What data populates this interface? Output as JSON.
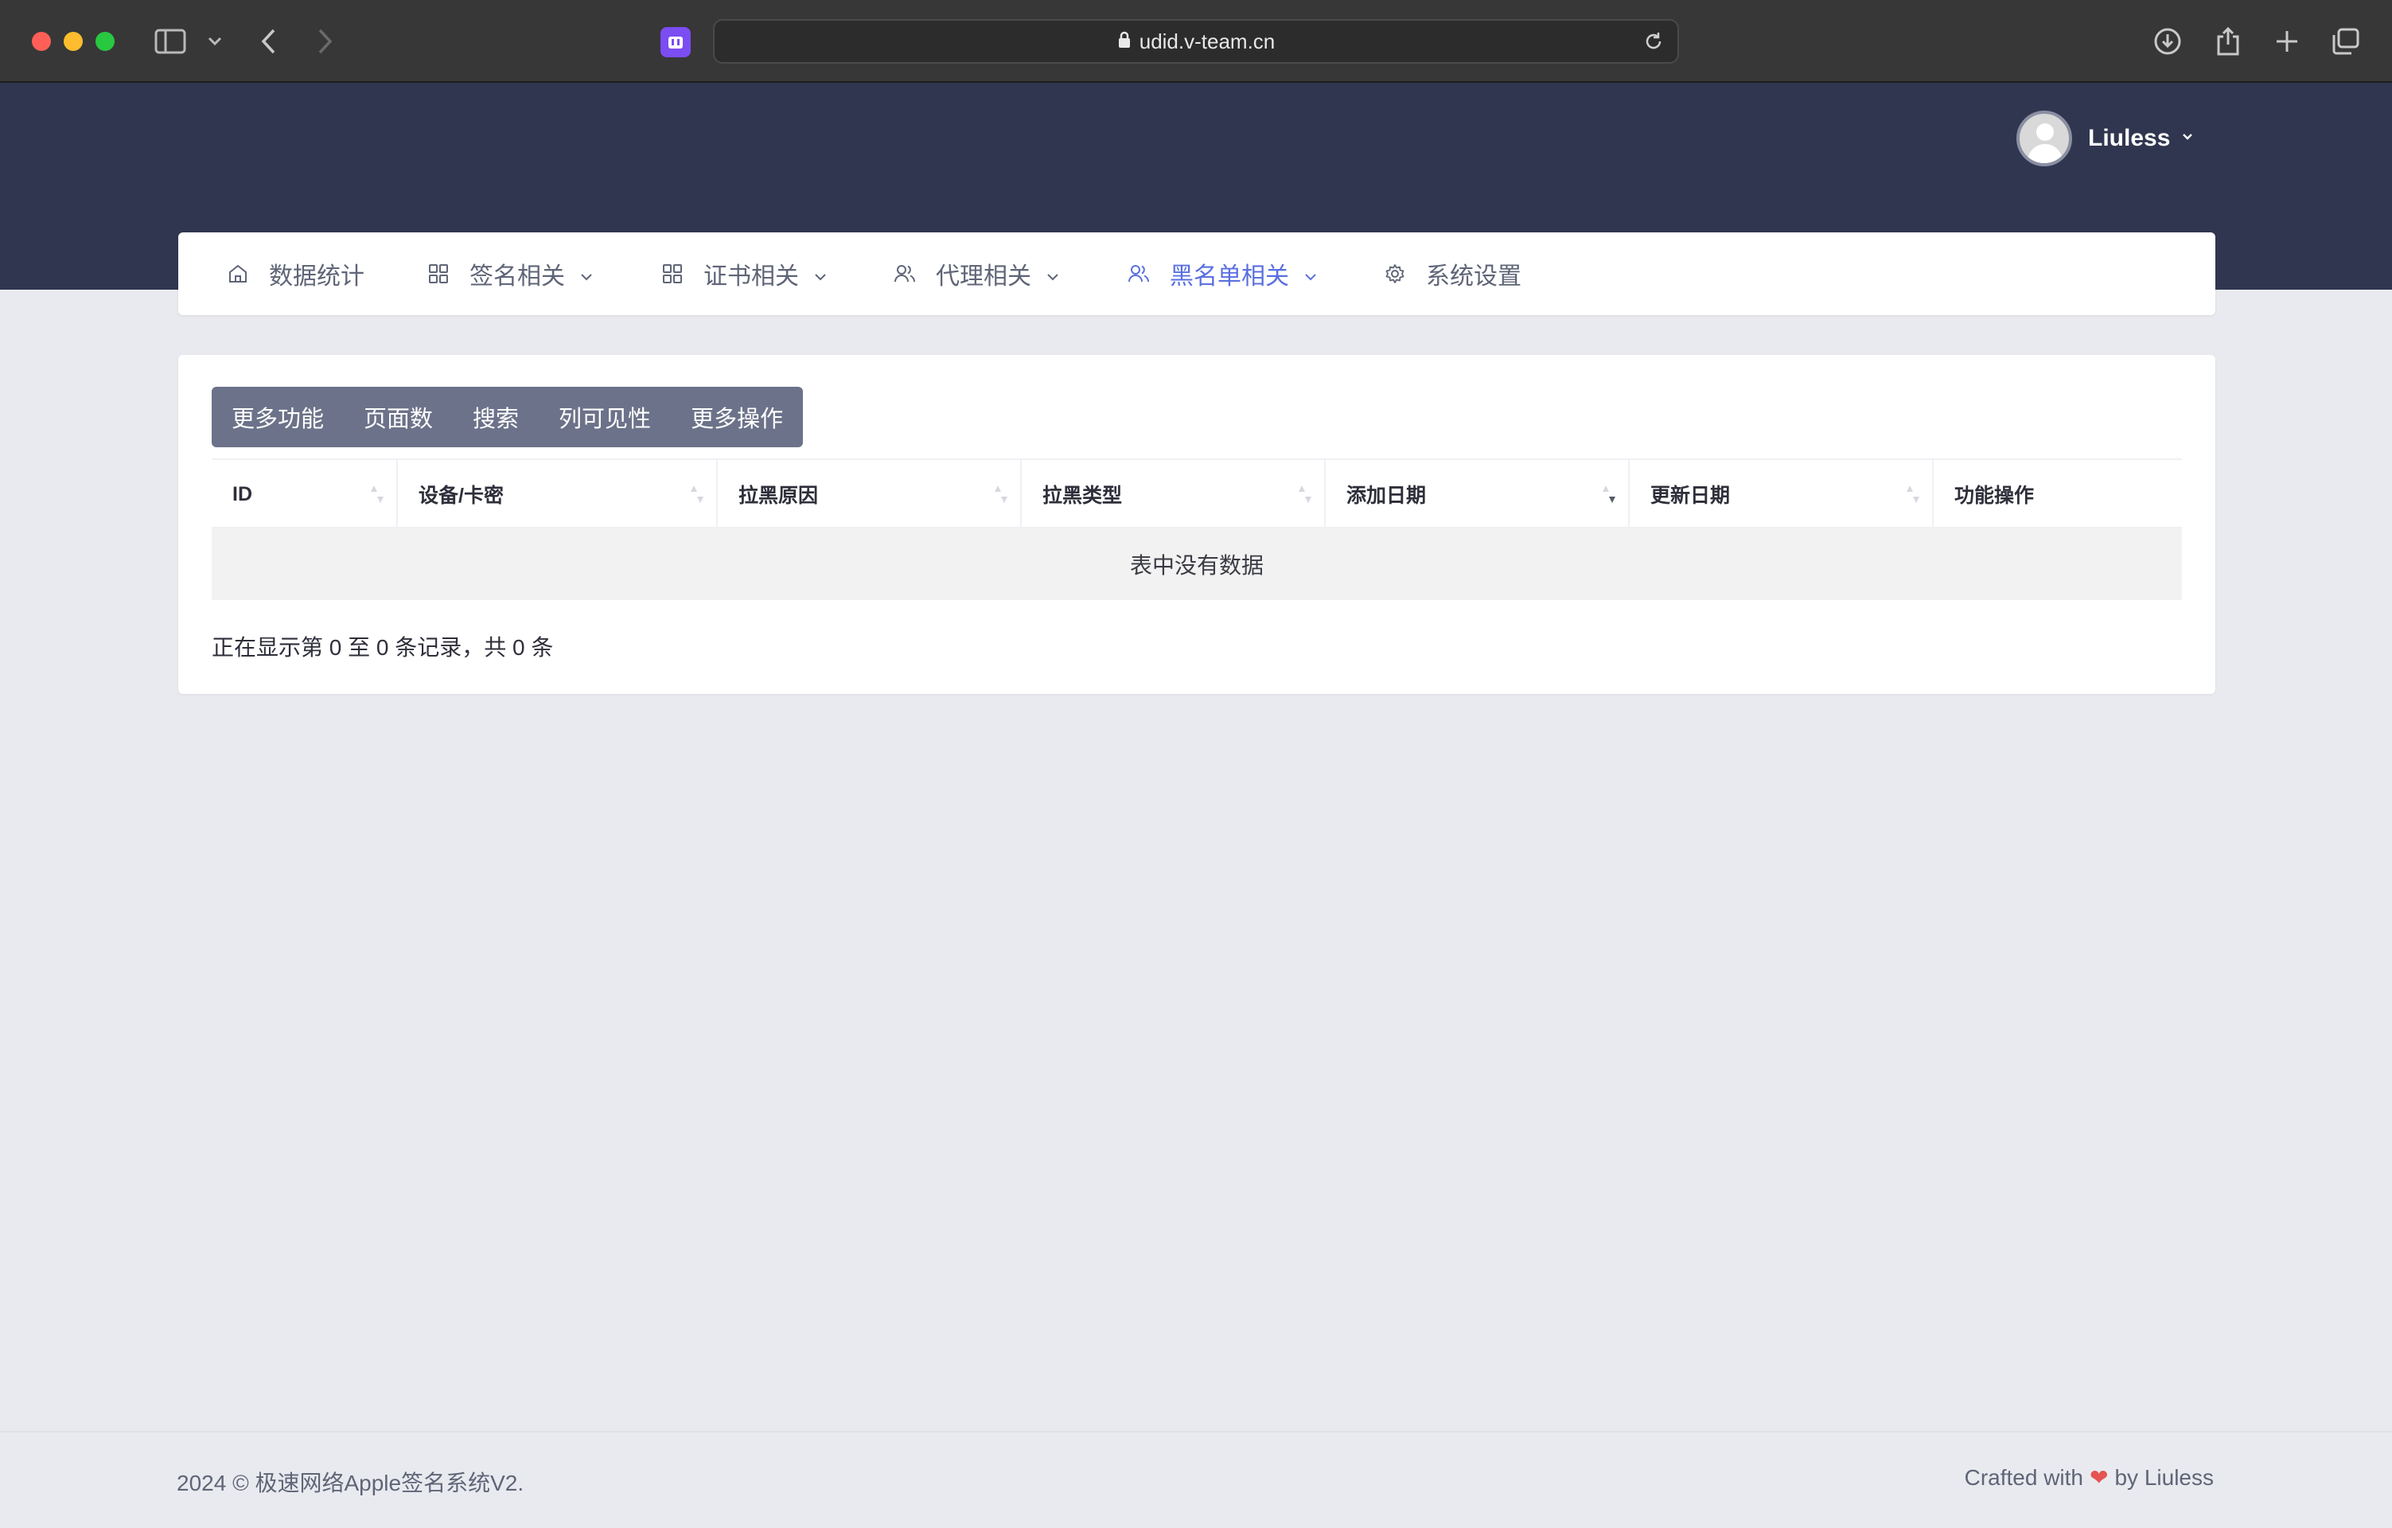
{
  "browser": {
    "url": "udid.v-team.cn"
  },
  "header": {
    "user_name": "Liuless"
  },
  "nav": {
    "items": [
      {
        "label": "数据统计",
        "icon": "home-icon",
        "dropdown": false
      },
      {
        "label": "签名相关",
        "icon": "grid-icon",
        "dropdown": true
      },
      {
        "label": "证书相关",
        "icon": "grid-icon",
        "dropdown": true
      },
      {
        "label": "代理相关",
        "icon": "users-icon",
        "dropdown": true
      },
      {
        "label": "黑名单相关",
        "icon": "users-icon",
        "dropdown": true,
        "active": true
      },
      {
        "label": "系统设置",
        "icon": "gear-icon",
        "dropdown": false
      }
    ]
  },
  "toolbar": {
    "buttons": [
      "更多功能",
      "页面数",
      "搜索",
      "列可见性",
      "更多操作"
    ]
  },
  "table": {
    "columns": [
      "ID",
      "设备/卡密",
      "拉黑原因",
      "拉黑类型",
      "添加日期",
      "更新日期",
      "功能操作"
    ],
    "empty_message": "表中没有数据",
    "info": "正在显示第 0 至 0 条记录，共 0 条"
  },
  "footer": {
    "copyright": "2024 © 极速网络Apple签名系统V2.",
    "crafted_prefix": "Crafted with",
    "heart": "❤",
    "crafted_suffix": "by Liuless"
  },
  "colors": {
    "header_bg": "#30364f",
    "active_nav": "#5a6fe0",
    "button_group_bg": "#6c7289",
    "page_bg": "#e9eaef",
    "heart": "#e55353"
  }
}
